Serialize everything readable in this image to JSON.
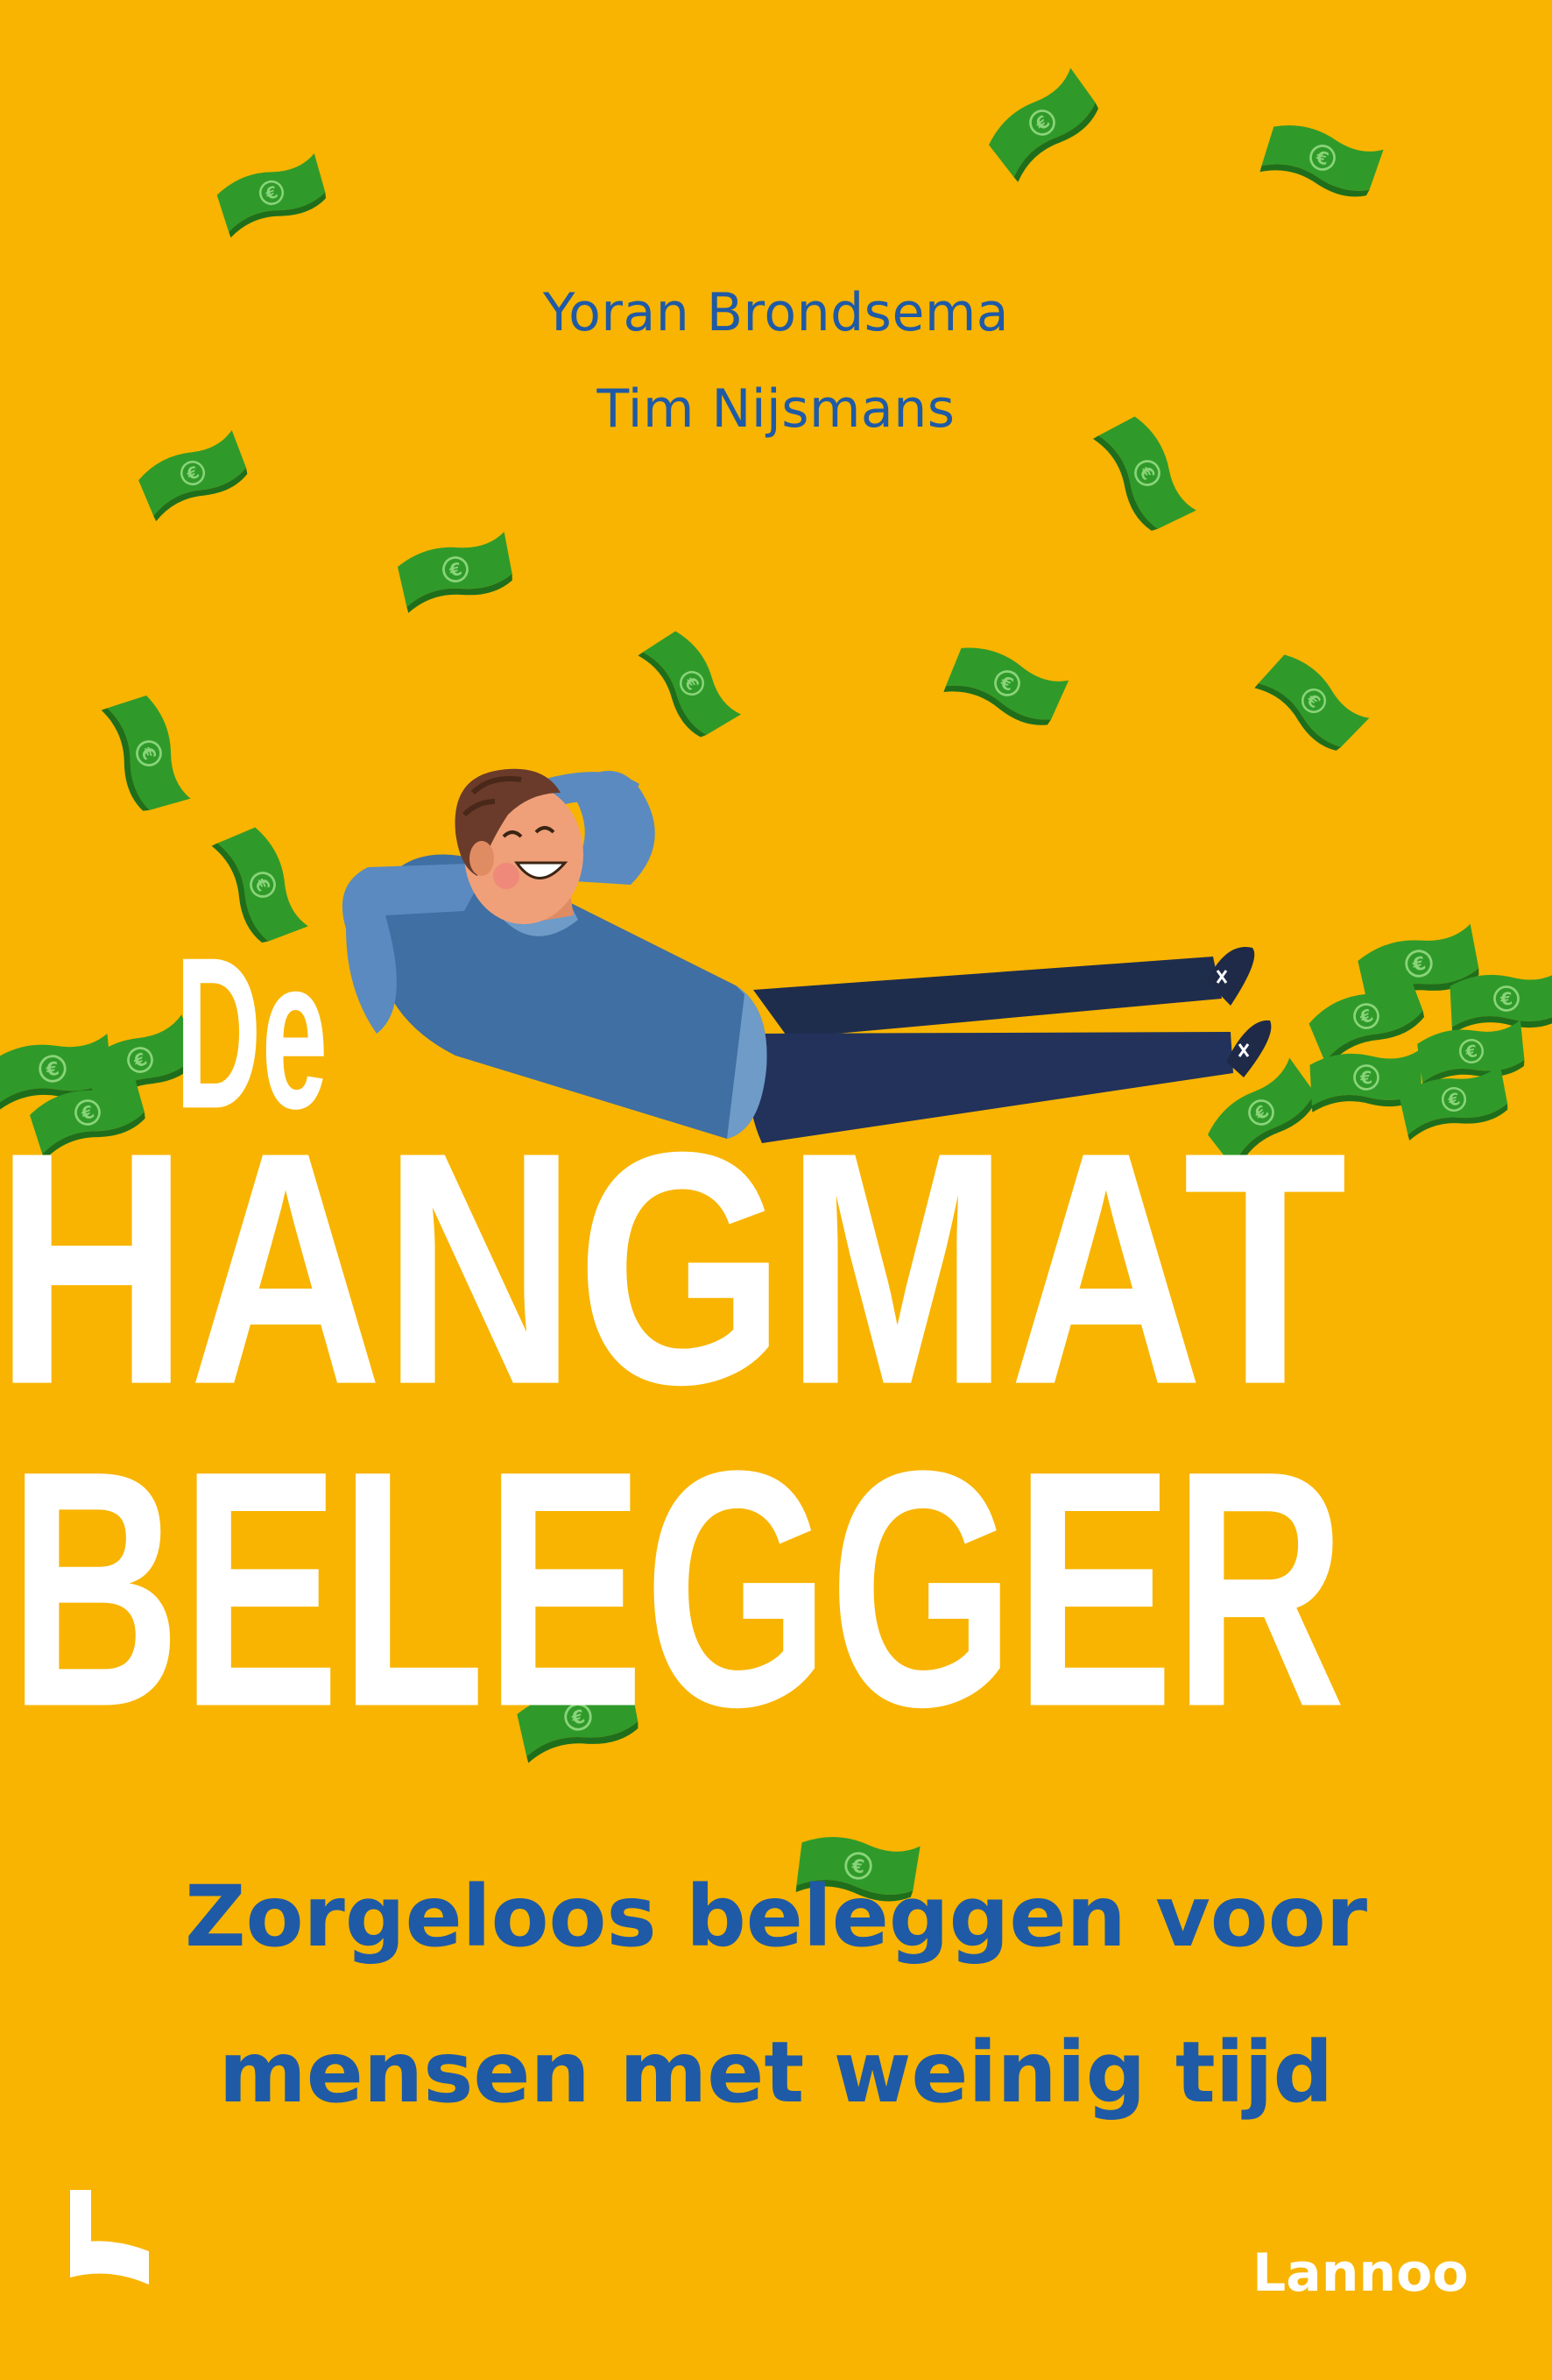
{
  "cover": {
    "background_color": "#f8b400",
    "accent_color": "#1f5aa6",
    "bill_color": "#2f9a2a"
  },
  "authors": [
    "Yoran Brondsema",
    "Tim Nijsmans"
  ],
  "title": {
    "line1": "De",
    "line2": "HANGMAT",
    "line3": "BELEGGER"
  },
  "subtitle": {
    "line1": "Zorgeloos beleggen voor",
    "line2": "mensen met weinig tijd"
  },
  "publisher": {
    "name": "Lannoo",
    "logo_icon": "lannoo-l-logo-icon"
  },
  "illustration": {
    "person_icon": "relaxing-man-illustration",
    "bill_icon": "euro-banknote-icon"
  }
}
